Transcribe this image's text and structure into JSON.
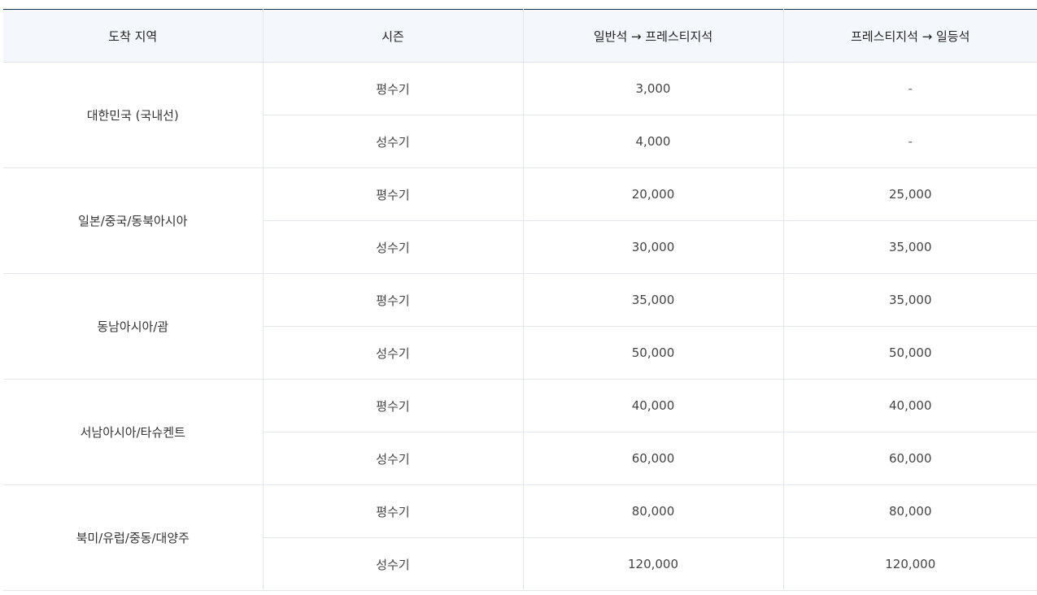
{
  "table": {
    "headers": [
      "도착 지역",
      "시즌",
      "일반석 → 프레스티지석",
      "프레스티지석 → 일등석"
    ],
    "regions": [
      {
        "name": "대한민국 (국내선)",
        "rows": [
          {
            "season": "평수기",
            "economy_to_prestige": "3,000",
            "prestige_to_first": "-"
          },
          {
            "season": "성수기",
            "economy_to_prestige": "4,000",
            "prestige_to_first": "-"
          }
        ]
      },
      {
        "name": "일본/중국/동북아시아",
        "rows": [
          {
            "season": "평수기",
            "economy_to_prestige": "20,000",
            "prestige_to_first": "25,000"
          },
          {
            "season": "성수기",
            "economy_to_prestige": "30,000",
            "prestige_to_first": "35,000"
          }
        ]
      },
      {
        "name": "동남아시아/괌",
        "rows": [
          {
            "season": "평수기",
            "economy_to_prestige": "35,000",
            "prestige_to_first": "35,000"
          },
          {
            "season": "성수기",
            "economy_to_prestige": "50,000",
            "prestige_to_first": "50,000"
          }
        ]
      },
      {
        "name": "서남아시아/타슈켄트",
        "rows": [
          {
            "season": "평수기",
            "economy_to_prestige": "40,000",
            "prestige_to_first": "40,000"
          },
          {
            "season": "성수기",
            "economy_to_prestige": "60,000",
            "prestige_to_first": "60,000"
          }
        ]
      },
      {
        "name": "북미/유럽/중동/대양주",
        "rows": [
          {
            "season": "평수기",
            "economy_to_prestige": "80,000",
            "prestige_to_first": "80,000"
          },
          {
            "season": "성수기",
            "economy_to_prestige": "120,000",
            "prestige_to_first": "120,000"
          }
        ]
      }
    ]
  }
}
